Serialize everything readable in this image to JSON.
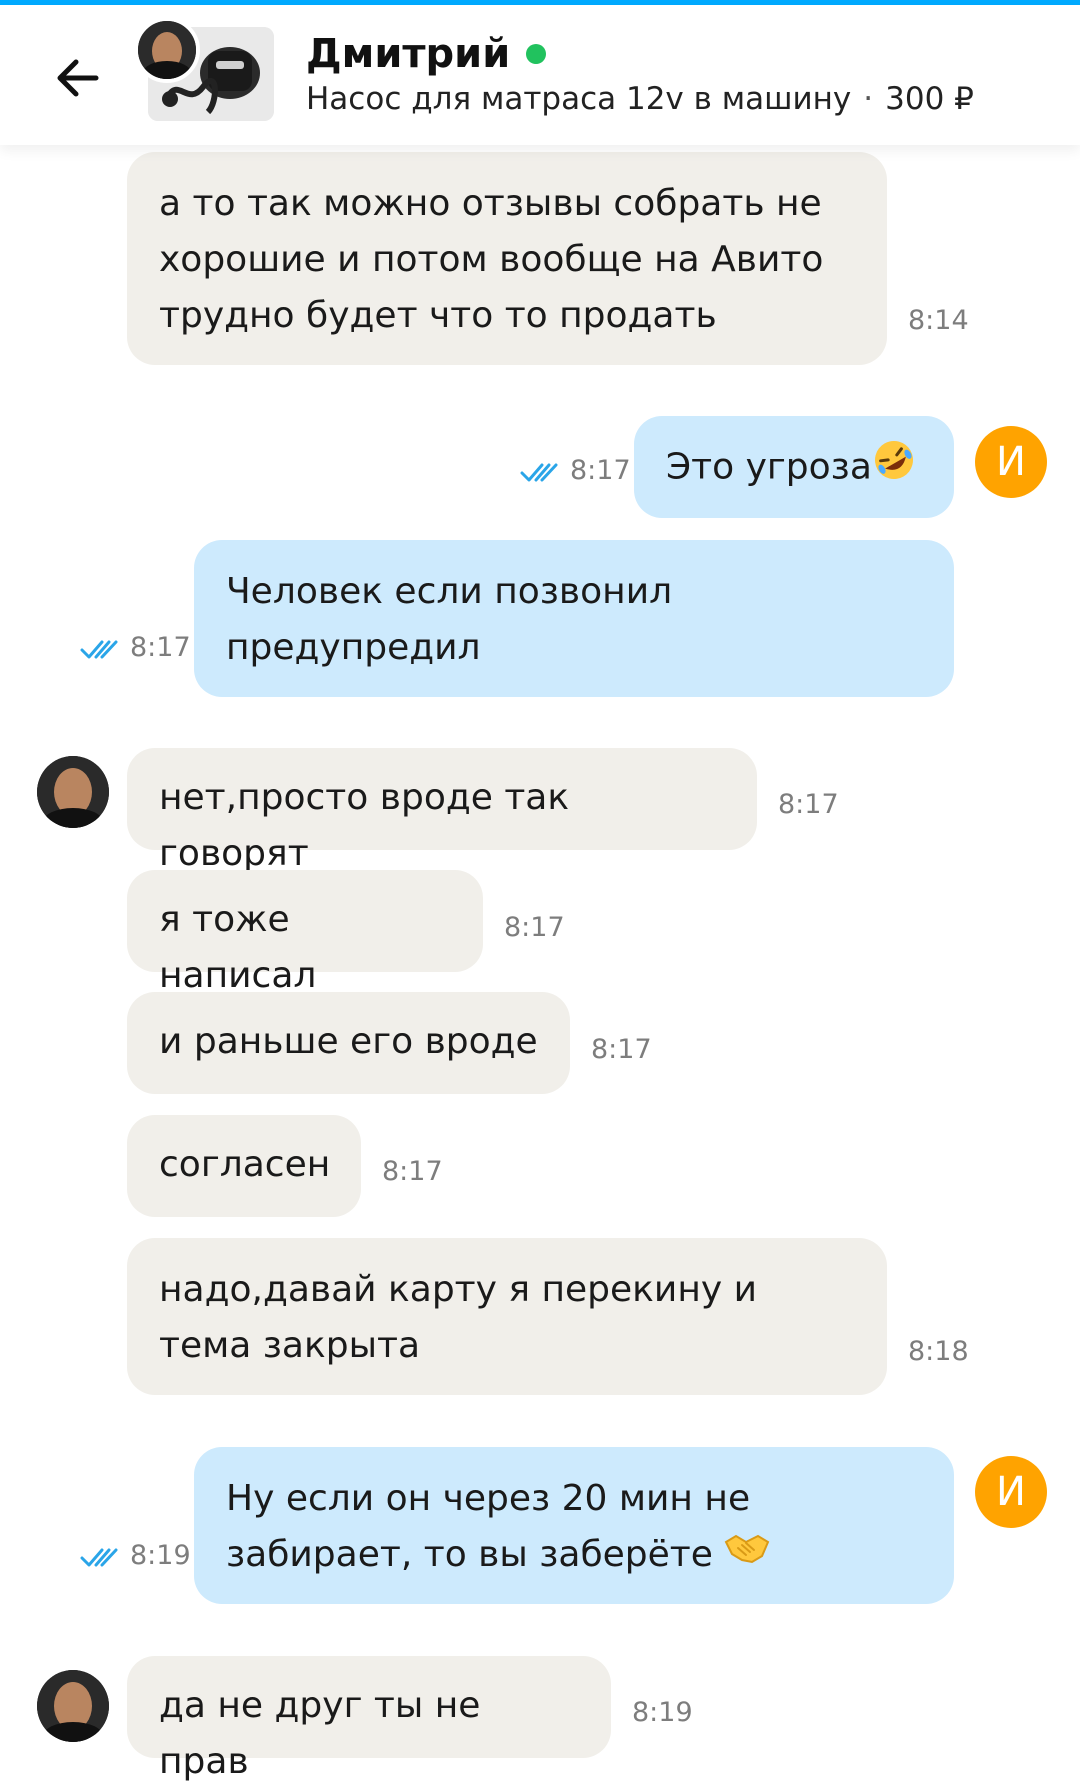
{
  "header": {
    "contact_name": "Дмитрий",
    "online": true,
    "listing_title": "Насос для матраса 12v в машину",
    "listing_separator": "·",
    "listing_price": "300 ₽"
  },
  "me": {
    "avatar_letter": "И"
  },
  "messages": [
    {
      "direction": "in",
      "text": "а то так можно отзывы собрать не хорошие и потом вообще на Авито трудно будет что то продать",
      "time": "8:14"
    },
    {
      "direction": "out",
      "text": "Это угроза",
      "emoji": "rolling-on-floor-laughing-emoji",
      "time": "8:17",
      "read": true
    },
    {
      "direction": "out",
      "text": "Человек если позвонил предупредил",
      "time": "8:17",
      "read": true
    },
    {
      "direction": "in",
      "text": "нет,просто вроде так говорят",
      "time": "8:17"
    },
    {
      "direction": "in",
      "text": "я тоже написал",
      "time": "8:17"
    },
    {
      "direction": "in",
      "text": "и раньше его вроде",
      "time": "8:17"
    },
    {
      "direction": "in",
      "text": "согласен",
      "time": "8:17"
    },
    {
      "direction": "in",
      "text": "надо,давай карту я перекину и тема закрыта",
      "time": "8:18"
    },
    {
      "direction": "out",
      "text": "Ну если он через 20 мин не забирает, то вы заберёте",
      "emoji": "handshake-emoji",
      "time": "8:19",
      "read": true
    },
    {
      "direction": "in",
      "text": "да не друг ты не прав",
      "time": "8:19"
    }
  ],
  "colors": {
    "accent": "#00aaff",
    "incoming_bubble": "#f1efea",
    "outgoing_bubble": "#cdeafd",
    "online": "#21c25e",
    "my_avatar": "#ffa300",
    "read_ticks": "#2aa5e8"
  }
}
